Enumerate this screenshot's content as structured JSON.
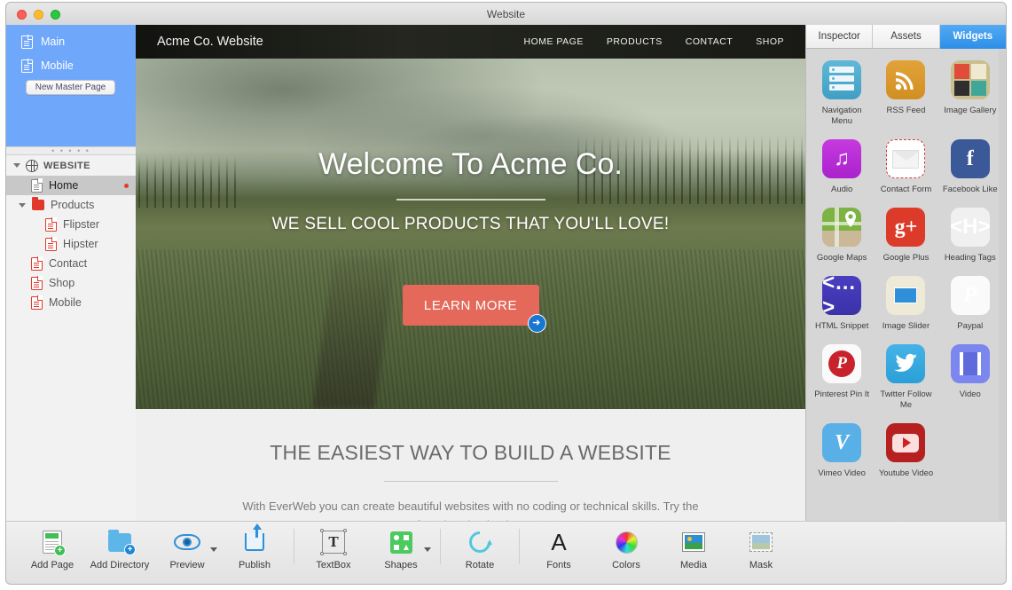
{
  "window": {
    "title": "Website",
    "controls": [
      "close",
      "minimize",
      "zoom"
    ]
  },
  "sidebar": {
    "master_pages": [
      {
        "label": "Main",
        "icon": "page-icon"
      },
      {
        "label": "Mobile",
        "icon": "page-icon"
      }
    ],
    "new_master_page_button": "New Master Page",
    "tree_header": "WEBSITE",
    "pages": [
      {
        "label": "Home",
        "icon": "page-icon",
        "indent": 1,
        "selected": true,
        "marker": true
      },
      {
        "label": "Products",
        "icon": "folder-icon",
        "indent": 1,
        "selected": false,
        "expandable": true
      },
      {
        "label": "Flipster",
        "icon": "page-icon",
        "indent": 2,
        "selected": false
      },
      {
        "label": "Hipster",
        "icon": "page-icon",
        "indent": 2,
        "selected": false
      },
      {
        "label": "Contact",
        "icon": "page-icon",
        "indent": 1,
        "selected": false
      },
      {
        "label": "Shop",
        "icon": "page-icon",
        "indent": 1,
        "selected": false
      },
      {
        "label": "Mobile",
        "icon": "page-icon",
        "indent": 1,
        "selected": false
      }
    ]
  },
  "canvas": {
    "site_nav": {
      "logo": "Acme Co. Website",
      "menu": [
        "HOME PAGE",
        "PRODUCTS",
        "CONTACT",
        "SHOP"
      ]
    },
    "hero": {
      "title": "Welcome To Acme Co.",
      "subtitle": "WE SELL COOL PRODUCTS THAT YOU'LL LOVE!",
      "cta_label": "LEARN MORE",
      "cta_color": "#e4695a",
      "badge_icon": "arrow-right-icon",
      "badge_color": "#1877d2"
    },
    "lower": {
      "title": "THE EASIEST WAY TO BUILD A WEBSITE",
      "body": "With EverWeb you can create beautiful websites with no coding or technical skills. Try the free download today!"
    }
  },
  "right_panel": {
    "tabs": [
      {
        "label": "Inspector",
        "active": false
      },
      {
        "label": "Assets",
        "active": false
      },
      {
        "label": "Widgets",
        "active": true
      }
    ],
    "accent_color": "#2f90e8",
    "widgets": [
      {
        "label": "Navigation Menu",
        "icon": "navigation-menu-icon"
      },
      {
        "label": "RSS Feed",
        "icon": "rss-feed-icon"
      },
      {
        "label": "Image Gallery",
        "icon": "image-gallery-icon"
      },
      {
        "label": "Audio",
        "icon": "audio-icon"
      },
      {
        "label": "Contact Form",
        "icon": "contact-form-icon"
      },
      {
        "label": "Facebook Like",
        "icon": "facebook-icon"
      },
      {
        "label": "Google Maps",
        "icon": "google-maps-icon"
      },
      {
        "label": "Google Plus",
        "icon": "google-plus-icon"
      },
      {
        "label": "Heading Tags",
        "icon": "heading-tags-icon"
      },
      {
        "label": "HTML Snippet",
        "icon": "html-snippet-icon"
      },
      {
        "label": "Image Slider",
        "icon": "image-slider-icon"
      },
      {
        "label": "Paypal",
        "icon": "paypal-icon"
      },
      {
        "label": "Pinterest Pin It",
        "icon": "pinterest-icon"
      },
      {
        "label": "Twitter Follow Me",
        "icon": "twitter-icon"
      },
      {
        "label": "Video",
        "icon": "video-icon"
      },
      {
        "label": "Vimeo Video",
        "icon": "vimeo-icon"
      },
      {
        "label": "Youtube Video",
        "icon": "youtube-icon"
      }
    ]
  },
  "toolbar": {
    "items": [
      {
        "label": "Add Page",
        "icon": "add-page-icon",
        "caret": false
      },
      {
        "label": "Add Directory",
        "icon": "add-directory-icon",
        "caret": false
      },
      {
        "label": "Preview",
        "icon": "preview-eye-icon",
        "caret": true
      },
      {
        "label": "Publish",
        "icon": "publish-upload-icon",
        "caret": false
      },
      {
        "label": "TextBox",
        "icon": "textbox-icon",
        "caret": false
      },
      {
        "label": "Shapes",
        "icon": "shapes-icon",
        "caret": true
      },
      {
        "label": "Rotate",
        "icon": "rotate-icon",
        "caret": false
      },
      {
        "label": "Fonts",
        "icon": "fonts-icon",
        "caret": false
      },
      {
        "label": "Colors",
        "icon": "colors-wheel-icon",
        "caret": false
      },
      {
        "label": "Media",
        "icon": "media-icon",
        "caret": false
      },
      {
        "label": "Mask",
        "icon": "mask-icon",
        "caret": false
      }
    ]
  }
}
